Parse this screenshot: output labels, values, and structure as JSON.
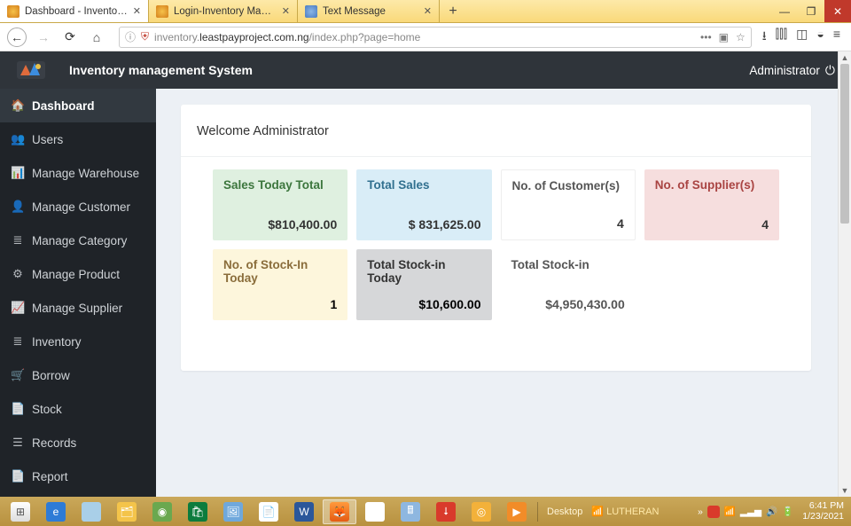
{
  "window": {
    "tabs": [
      {
        "label": "Dashboard - Inventory Manage"
      },
      {
        "label": "Login-Inventory Management"
      },
      {
        "label": "Text Message"
      }
    ],
    "url_host": "leastpayproject.com.ng",
    "url_prefix": "inventory.",
    "url_path": "/index.php?page=home"
  },
  "header": {
    "brand": "Inventory management System",
    "user": "Administrator"
  },
  "sidebar": {
    "items": [
      {
        "label": "Dashboard"
      },
      {
        "label": "Users"
      },
      {
        "label": "Manage Warehouse"
      },
      {
        "label": "Manage Customer"
      },
      {
        "label": "Manage Category"
      },
      {
        "label": "Manage Product"
      },
      {
        "label": "Manage Supplier"
      },
      {
        "label": "Inventory"
      },
      {
        "label": "Borrow"
      },
      {
        "label": "Stock"
      },
      {
        "label": "Records"
      },
      {
        "label": "Report"
      }
    ]
  },
  "main": {
    "welcome": "Welcome Administrator",
    "tiles": [
      {
        "title": "Sales Today Total",
        "value": "$810,400.00"
      },
      {
        "title": "Total Sales",
        "value": "$ 831,625.00"
      },
      {
        "title": "No. of Customer(s)",
        "value": "4"
      },
      {
        "title": "No. of Supplier(s)",
        "value": "4"
      },
      {
        "title": "No. of Stock-In Today",
        "value": "1"
      },
      {
        "title": "Total Stock-in Today",
        "value": "$10,600.00"
      },
      {
        "title": "Total Stock-in",
        "value": "$4,950,430.00"
      }
    ]
  },
  "taskbar": {
    "desktop_label": "Desktop",
    "net_label": "LUTHERAN",
    "time": "6:41 PM",
    "date": "1/23/2021"
  }
}
